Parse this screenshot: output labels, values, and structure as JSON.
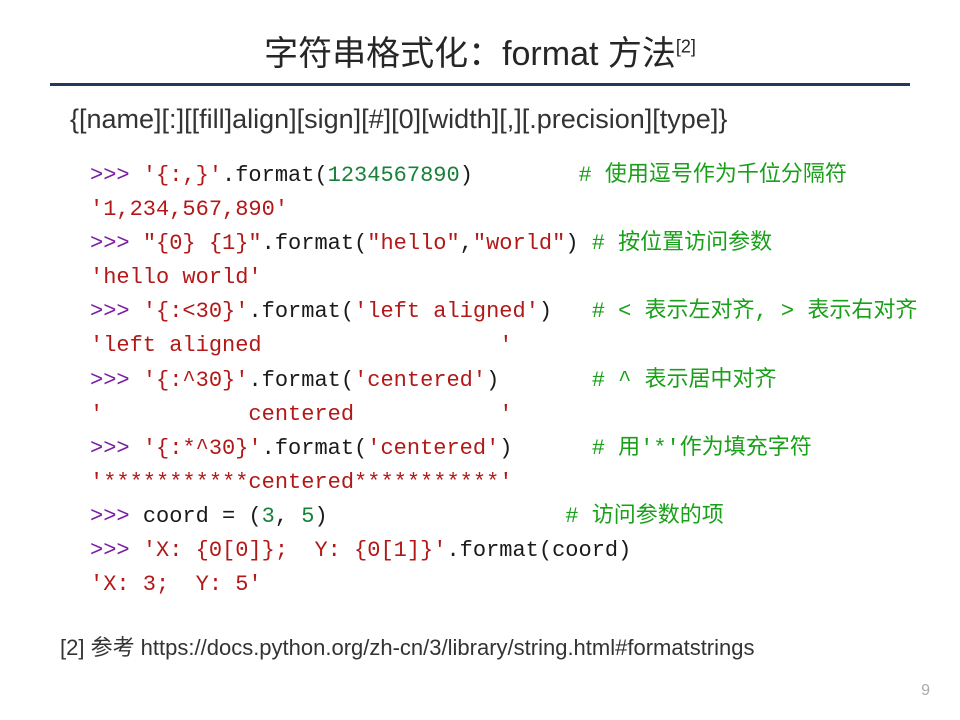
{
  "title_main": "字符串格式化：format 方法",
  "title_ref": "[2]",
  "syntax_line": "{[name][:][[fill]align][sign][#][0][width][,][.precision][type]}",
  "code": {
    "l1_prompt": ">>> ",
    "l1_str": "'{:,}'",
    "l1_meth": ".format(",
    "l1_arg": "1234567890",
    "l1_close": ")",
    "l1_comment": "# 使用逗号作为千位分隔符",
    "l2_out": "'1,234,567,890'",
    "l3_prompt": ">>> ",
    "l3_str": "\"{0} {1}\"",
    "l3_meth": ".format(",
    "l3_a1": "\"hello\"",
    "l3_comma": ",",
    "l3_a2": "\"world\"",
    "l3_close": ")",
    "l3_comment": "# 按位置访问参数",
    "l4_out": "'hello world'",
    "l5_prompt": ">>> ",
    "l5_str": "'{:<30}'",
    "l5_meth": ".format(",
    "l5_arg": "'left aligned'",
    "l5_close": ")",
    "l5_comment": "# < 表示左对齐, > 表示右对齐",
    "l6_out": "'left aligned                  '",
    "l7_prompt": ">>> ",
    "l7_str": "'{:^30}'",
    "l7_meth": ".format(",
    "l7_arg": "'centered'",
    "l7_close": ")",
    "l7_comment": "# ^ 表示居中对齐",
    "l8_out": "'           centered           '",
    "l9_prompt": ">>> ",
    "l9_str": "'{:*^30}'",
    "l9_meth": ".format(",
    "l9_arg": "'centered'",
    "l9_close": ")",
    "l9_comment": "# 用'*'作为填充字符",
    "l10_out": "'***********centered***********'",
    "l11_prompt": ">>> ",
    "l11_var": "coord = (",
    "l11_n1": "3",
    "l11_c": ", ",
    "l11_n2": "5",
    "l11_end": ")",
    "l11_comment": "# 访问参数的项",
    "l12_prompt": ">>> ",
    "l12_str": "'X: {0[0]};  Y: {0[1]}'",
    "l12_meth": ".format(coord)",
    "l13_out": "'X: 3;  Y: 5'"
  },
  "footnote": "[2] 参考 https://docs.python.org/zh-cn/3/library/string.html#formatstrings",
  "page_number": "9"
}
